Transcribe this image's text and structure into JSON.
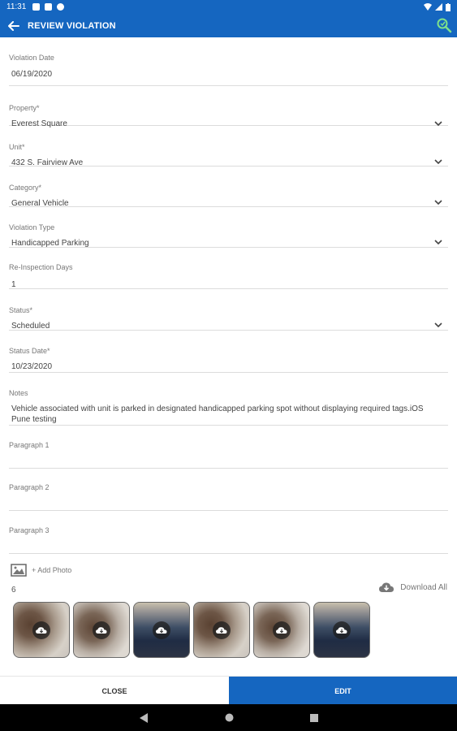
{
  "status_bar": {
    "time": "11:31"
  },
  "app_bar": {
    "title": "REVIEW VIOLATION"
  },
  "form": {
    "violation_date": {
      "label": "Violation Date",
      "value": "06/19/2020"
    },
    "property": {
      "label": "Property*",
      "value": "Everest Square"
    },
    "unit": {
      "label": "Unit*",
      "value": "432 S. Fairview Ave"
    },
    "category": {
      "label": "Category*",
      "value": "General Vehicle"
    },
    "violation_type": {
      "label": "Violation Type",
      "value": "Handicapped Parking"
    },
    "reinspection_days": {
      "label": "Re-Inspection Days",
      "value": "1"
    },
    "status": {
      "label": "Status*",
      "value": "Scheduled"
    },
    "status_date": {
      "label": "Status Date*",
      "value": "10/23/2020"
    },
    "notes": {
      "label": "Notes",
      "value": "Vehicle associated with unit is parked in designated handicapped parking spot without displaying required tags.iOS Pune testing"
    },
    "paragraph1": {
      "label": "Paragraph 1",
      "value": ""
    },
    "paragraph2": {
      "label": "Paragraph 2",
      "value": ""
    },
    "paragraph3": {
      "label": "Paragraph 3",
      "value": ""
    }
  },
  "photos": {
    "add_label": "+ Add Photo",
    "count": "6",
    "download_all_label": "Download All",
    "items": [
      {
        "icon": "cloud-download-icon"
      },
      {
        "icon": "cloud-download-icon"
      },
      {
        "icon": "cloud-download-icon"
      },
      {
        "icon": "cloud-download-icon"
      },
      {
        "icon": "cloud-download-icon"
      },
      {
        "icon": "cloud-download-icon"
      }
    ]
  },
  "actions": {
    "close_label": "CLOSE",
    "edit_label": "EDIT"
  },
  "colors": {
    "primary": "#1566c0",
    "label": "#777777",
    "divider": "#dcdcdc"
  }
}
